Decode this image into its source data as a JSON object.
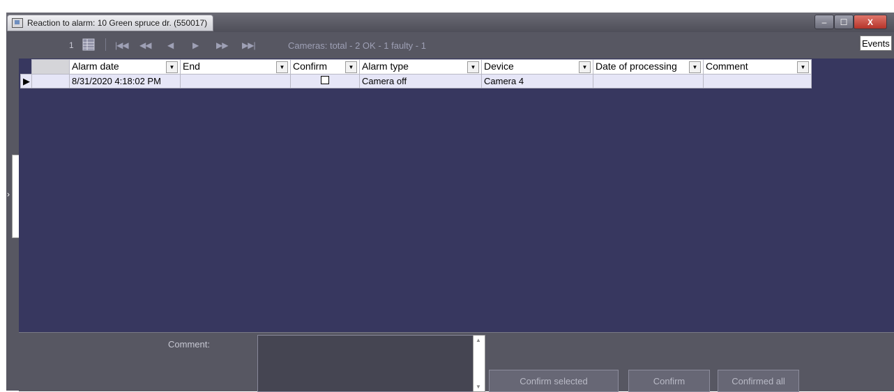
{
  "window": {
    "title": "Reaction to alarm: 10 Green spruce dr. (550017)",
    "controls": {
      "minimize": "–",
      "maximize": "☐",
      "close": "X"
    }
  },
  "toolbar": {
    "page_number": "1",
    "cameras_status": "Cameras: total - 2  OK - 1  faulty - 1",
    "events_label": "Events",
    "nav_icons": [
      "first-page-icon",
      "prev-fast-icon",
      "prev-icon",
      "next-icon",
      "next-fast-icon",
      "last-page-icon"
    ]
  },
  "table": {
    "columns": [
      "Alarm date",
      "End",
      "Confirm",
      "Alarm type",
      "Device",
      "Date of processing",
      "Comment"
    ],
    "rows": [
      {
        "alarm_date": "8/31/2020 4:18:02 PM",
        "end": "",
        "confirm": false,
        "alarm_type": "Camera off",
        "device": "Camera 4",
        "date_of_processing": "",
        "comment": ""
      }
    ]
  },
  "bottom": {
    "comment_label": "Comment:",
    "comment_value": "",
    "confirm_selected": "Confirm selected",
    "confirm": "Confirm",
    "confirmed_all": "Confirmed all"
  },
  "colors": {
    "grid_bg": "#37375f",
    "panel_bg": "#575762",
    "row_bg": "#e6e6f7"
  }
}
